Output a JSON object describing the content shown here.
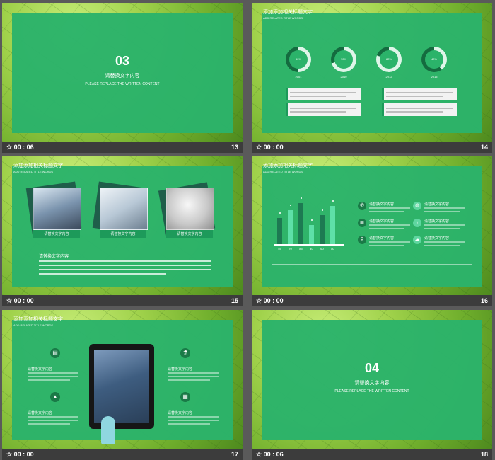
{
  "colors": {
    "panel": "#2bb36a",
    "dark_accent": "#1d9a5a",
    "bar": "#3c3c3c",
    "background": "#5a5a5a"
  },
  "section_title": {
    "line1": "添加添加相关标题文字",
    "line2": "ADD RELATED TITLE WORDS"
  },
  "placeholder": {
    "cn": "请替换文字内容",
    "en": "PLEASE REPLACE THE WRITTEN  CONTENT"
  },
  "body_cn": "请替换文字内容",
  "body_en": "Please replace text, click add relevant headline, modify the text content, also can copy your content to this directly.",
  "star_icon": "star-icon",
  "slides": [
    {
      "time": "00 : 06",
      "number": "13",
      "section": "03"
    },
    {
      "time": "00 : 00",
      "number": "14"
    },
    {
      "time": "00 : 00",
      "number": "15"
    },
    {
      "time": "00 : 00",
      "number": "16"
    },
    {
      "time": "00 : 00",
      "number": "17"
    },
    {
      "time": "00 : 06",
      "number": "18",
      "section": "04"
    }
  ],
  "donuts": [
    {
      "percent": 50,
      "label": "50%",
      "year": "2001"
    },
    {
      "percent": 70,
      "label": "70%",
      "year": "2010"
    },
    {
      "percent": 80,
      "label": "80%",
      "year": "2012"
    },
    {
      "percent": 40,
      "label": "40%",
      "year": "2015"
    }
  ],
  "chart_data": {
    "type": "bar",
    "categories": [
      "55",
      "70",
      "85",
      "40",
      "60",
      "80"
    ],
    "values": [
      55,
      70,
      85,
      40,
      60,
      80
    ],
    "ylim": [
      0,
      100
    ]
  },
  "icons_16": [
    "phone-icon",
    "globe-icon",
    "calendar-icon",
    "lightbulb-icon",
    "location-pin-icon",
    "cloud-upload-icon"
  ],
  "icons_17": [
    "briefcase-icon",
    "microscope-icon",
    "graduation-cap-icon",
    "calculator-icon"
  ]
}
